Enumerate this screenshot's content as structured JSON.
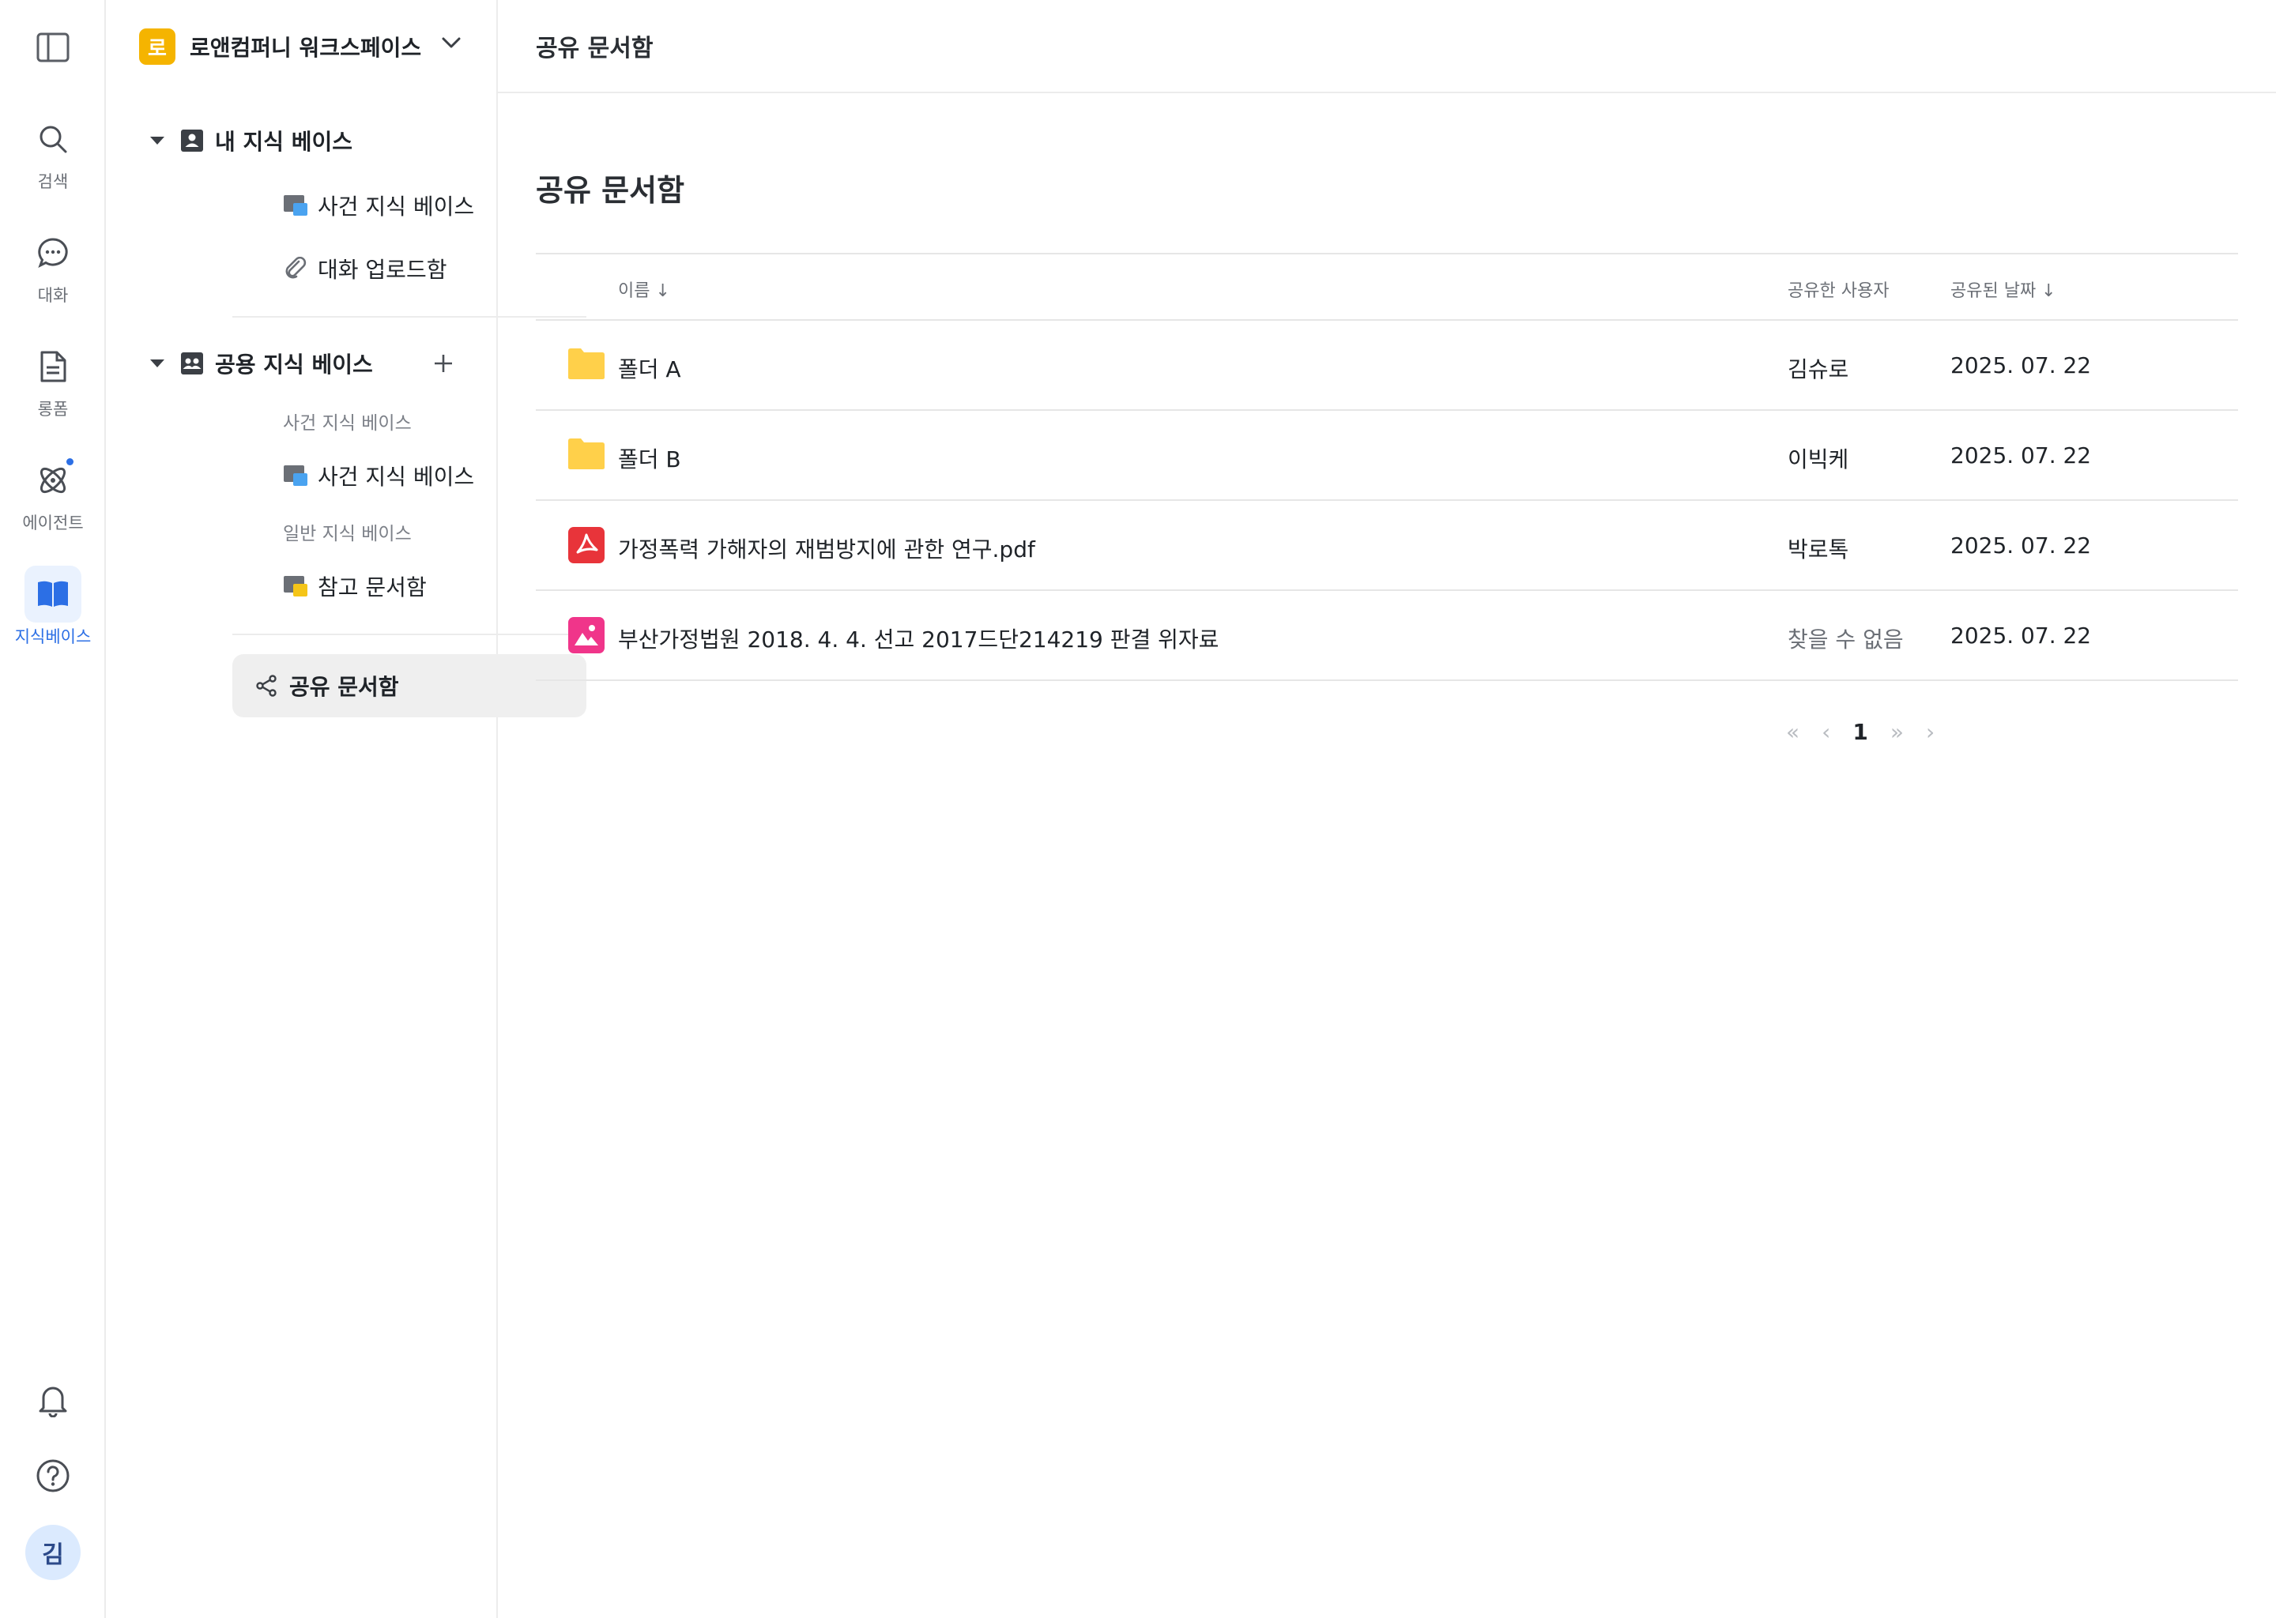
{
  "rail": {
    "items": [
      {
        "label": "검색"
      },
      {
        "label": "대화"
      },
      {
        "label": "롱폼"
      },
      {
        "label": "에이전트"
      },
      {
        "label": "지식베이스"
      }
    ],
    "avatar": "김"
  },
  "workspace": {
    "logo": "로",
    "name": "로앤컴퍼니 워크스페이스"
  },
  "sidebar": {
    "my_kb": {
      "title": "내 지식 베이스",
      "items": [
        "사건 지식 베이스",
        "대화 업로드함"
      ]
    },
    "shared_kb": {
      "title": "공용 지식 베이스",
      "groups": [
        {
          "label": "사건 지식 베이스",
          "items": [
            "사건 지식 베이스"
          ]
        },
        {
          "label": "일반 지식 베이스",
          "items": [
            "참고 문서함"
          ]
        }
      ]
    },
    "shared_box": "공유 문서함"
  },
  "main": {
    "topbar_title": "공유 문서함",
    "page_title": "공유 문서함",
    "columns": {
      "name": "이름 ↓",
      "shared_by": "공유한 사용자",
      "shared_date": "공유된 날짜 ↓"
    },
    "rows": [
      {
        "type": "folder",
        "name": "폴더 A",
        "shared_by": "김슈로",
        "date": "2025. 07. 22"
      },
      {
        "type": "folder",
        "name": "폴더 B",
        "shared_by": "이빅케",
        "date": "2025. 07. 22"
      },
      {
        "type": "pdf",
        "name": "가정폭력 가해자의 재범방지에 관한 연구.pdf",
        "shared_by": "박로톡",
        "date": "2025. 07. 22"
      },
      {
        "type": "image",
        "name": "부산가정법원 2018. 4. 4. 선고 2017드단214219 판결 위자료",
        "shared_by": "찾을 수 없음",
        "date": "2025. 07. 22"
      }
    ],
    "pager": {
      "first": "«",
      "prev": "‹",
      "current": "1",
      "last": "»",
      "next": "›"
    }
  },
  "colors": {
    "accent": "#2c6fe5",
    "workspace_logo": "#f5b400",
    "folder": "#ffd04a",
    "pdf": "#e8343a",
    "image": "#f0358a"
  }
}
